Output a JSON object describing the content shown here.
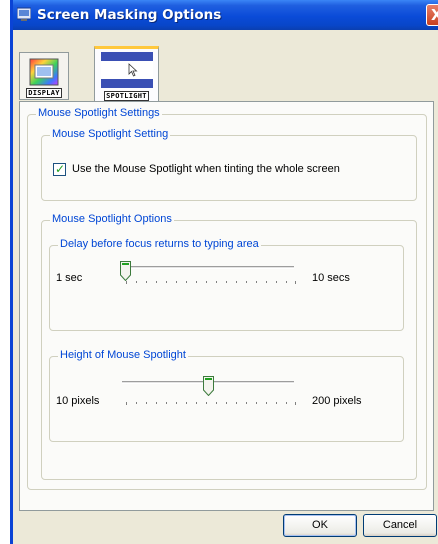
{
  "window": {
    "title": "Screen Masking Options",
    "close_label": "X"
  },
  "tabs": [
    {
      "label": "DISPLAY",
      "icon": "display-icon",
      "selected": false
    },
    {
      "label": "SPOTLIGHT",
      "icon": "spotlight-icon",
      "selected": true
    }
  ],
  "main": {
    "settings_group": "Mouse Spotlight Settings",
    "setting_group": "Mouse Spotlight Setting",
    "checkbox": {
      "label": "Use the Mouse Spotlight when tinting the whole screen",
      "checked": true
    },
    "options_group": "Mouse Spotlight Options",
    "delay": {
      "group": "Delay before focus returns to typing area",
      "min_label": "1 sec",
      "max_label": "10 secs",
      "level": 0.0
    },
    "height": {
      "group": "Height of Mouse Spotlight",
      "min_label": "10 pixels",
      "max_label": "200 pixels",
      "level": 0.5
    }
  },
  "buttons": {
    "ok": "OK",
    "cancel": "Cancel"
  },
  "colors": {
    "titlebar": "#0a4bd8",
    "group_label": "#0046d5",
    "dialog_face": "#ece9d8",
    "check": "#21a121"
  }
}
